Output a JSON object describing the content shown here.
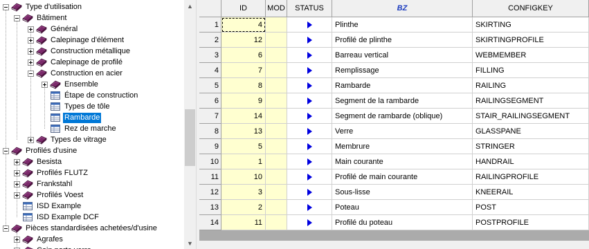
{
  "tree": {
    "items": [
      {
        "label": "Type d'utilisation",
        "icon": "book-icon"
      },
      {
        "label": "Bâtiment",
        "icon": "book-icon"
      },
      {
        "label": "Général",
        "icon": "book-icon"
      },
      {
        "label": "Calepinage d'élément",
        "icon": "book-icon"
      },
      {
        "label": "Construction métallique",
        "icon": "book-icon"
      },
      {
        "label": "Calepinage de profilé",
        "icon": "book-icon"
      },
      {
        "label": "Construction en acier",
        "icon": "book-icon"
      },
      {
        "label": "Ensemble",
        "icon": "book-icon"
      },
      {
        "label": "Étape de construction",
        "icon": "table-icon"
      },
      {
        "label": "Types de tôle",
        "icon": "table-icon"
      },
      {
        "label": "Rambarde",
        "icon": "table-icon"
      },
      {
        "label": "Rez de marche",
        "icon": "table-icon"
      },
      {
        "label": "Types de vitrage",
        "icon": "book-icon"
      },
      {
        "label": "Profilés d'usine",
        "icon": "book-icon"
      },
      {
        "label": "Besista",
        "icon": "book-icon"
      },
      {
        "label": "Profilés FLUTZ",
        "icon": "book-icon"
      },
      {
        "label": "Frankstahl",
        "icon": "book-icon"
      },
      {
        "label": "Profilés Voest",
        "icon": "book-icon"
      },
      {
        "label": "ISD Example",
        "icon": "table-icon"
      },
      {
        "label": "ISD Example DCF",
        "icon": "table-icon"
      },
      {
        "label": "Pièces standardisées achetées/d'usine",
        "icon": "book-icon"
      },
      {
        "label": "Agrafes",
        "icon": "book-icon"
      },
      {
        "label": "Coin porte verre",
        "icon": "book-icon"
      }
    ],
    "selected": "Rambarde"
  },
  "grid": {
    "columns": [
      "ID",
      "MOD",
      "STATUS",
      "BZ",
      "CONFIGKEY"
    ],
    "rows": [
      {
        "n": "1",
        "id": "4",
        "mod": "",
        "bz": "Plinthe",
        "key": "SKIRTING"
      },
      {
        "n": "2",
        "id": "12",
        "mod": "",
        "bz": "Profilé de plinthe",
        "key": "SKIRTINGPROFILE"
      },
      {
        "n": "3",
        "id": "6",
        "mod": "",
        "bz": "Barreau vertical",
        "key": "WEBMEMBER"
      },
      {
        "n": "4",
        "id": "7",
        "mod": "",
        "bz": "Remplissage",
        "key": "FILLING"
      },
      {
        "n": "5",
        "id": "8",
        "mod": "",
        "bz": "Rambarde",
        "key": "RAILING"
      },
      {
        "n": "6",
        "id": "9",
        "mod": "",
        "bz": "Segment de la rambarde",
        "key": "RAILINGSEGMENT"
      },
      {
        "n": "7",
        "id": "14",
        "mod": "",
        "bz": "Segment de rambarde (oblique)",
        "key": "STAIR_RAILINGSEGMENT"
      },
      {
        "n": "8",
        "id": "13",
        "mod": "",
        "bz": "Verre",
        "key": "GLASSPANE"
      },
      {
        "n": "9",
        "id": "5",
        "mod": "",
        "bz": "Membrure",
        "key": "STRINGER"
      },
      {
        "n": "10",
        "id": "1",
        "mod": "",
        "bz": "Main courante",
        "key": "HANDRAIL"
      },
      {
        "n": "11",
        "id": "10",
        "mod": "",
        "bz": "Profilé de main courante",
        "key": "RAILINGPROFILE"
      },
      {
        "n": "12",
        "id": "3",
        "mod": "",
        "bz": "Sous-lisse",
        "key": "KNEERAIL"
      },
      {
        "n": "13",
        "id": "2",
        "mod": "",
        "bz": "Poteau",
        "key": "POST"
      },
      {
        "n": "14",
        "id": "11",
        "mod": "",
        "bz": "Profilé du poteau",
        "key": "POSTPROFILE"
      }
    ]
  },
  "colors": {
    "selection": "#0078d7",
    "id_column": "#ffffd0",
    "status_arrow": "#0000e0",
    "bz_header": "#1f3fbf"
  }
}
